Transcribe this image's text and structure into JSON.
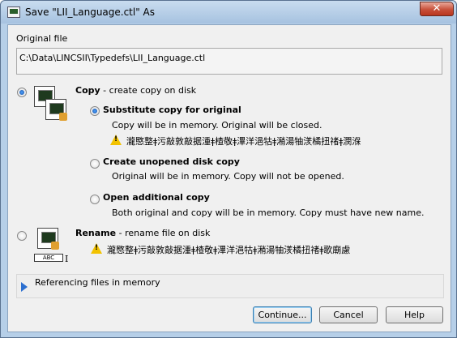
{
  "window": {
    "title": "Save \"LII_Language.ctl\" As",
    "close_glyph": "✕"
  },
  "original_file": {
    "label": "Original file",
    "path": "C:\\Data\\LINCSII\\Typedefs\\LII_Language.ctl"
  },
  "copy_option": {
    "title": "Copy",
    "desc": " - create copy on disk",
    "selected": true,
    "icon": "vi-copy-icon",
    "suboptions": [
      {
        "title": "Substitute copy for original",
        "desc": "Copy will be in memory. Original will be closed.",
        "warning": "瀧愍整ǂ污敲敦敲据湩ǂ楂敬ǂ滭洋浥牯ǂ潲湯牰湵橘扭禇ǂ潣湺",
        "selected": true
      },
      {
        "title": "Create unopened disk copy",
        "desc": "Original will be in memory. Copy will not be opened.",
        "selected": false
      },
      {
        "title": "Open additional copy",
        "desc": "Both original and copy will be in memory. Copy must have new name.",
        "selected": false
      }
    ]
  },
  "rename_option": {
    "title": "Rename",
    "desc": " - rename file on disk",
    "warning": "瀧愍整ǂ污敲敦敲据湩ǂ楂敬ǂ滭洋浥牯ǂ潲湯牰湵橘扭禇ǂ歌廟慮",
    "selected": false,
    "icon": "vi-rename-icon",
    "icon_text": "ABC"
  },
  "referencing": {
    "label": "Referencing files in memory",
    "icon": "expand-arrow-icon"
  },
  "buttons": {
    "continue": "Continue...",
    "cancel": "Cancel",
    "help": "Help"
  },
  "colors": {
    "accent": "#2c6fd0",
    "warning": "#f2c200",
    "window_frame": "#b6cfe8"
  }
}
